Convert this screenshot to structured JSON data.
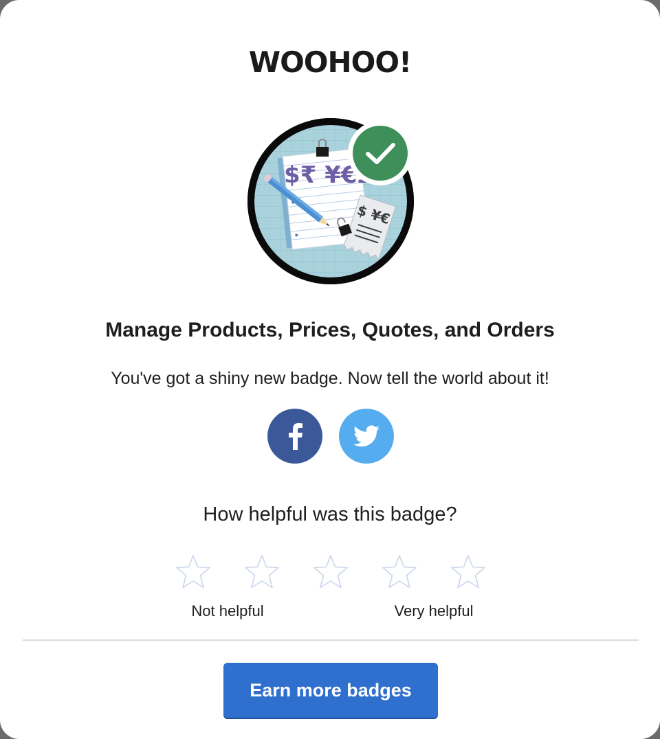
{
  "header": {
    "title": "WOOHOO!"
  },
  "badge": {
    "name": "Manage Products, Prices, Quotes, and Orders",
    "icon": "currency-notepad-badge-icon",
    "status_icon": "checkmark-icon",
    "currency_symbols_main": "$₹ ¥€£",
    "currency_symbols_receipt": "$ ¥€",
    "colors": {
      "badge_bg": "#a9d2dd",
      "ring": "#0a0a0a",
      "check_bg": "#3f8f5b",
      "currency": "#6e5fa5"
    }
  },
  "share": {
    "message": "You've got a shiny new badge. Now tell the world about it!",
    "facebook": {
      "icon": "facebook-icon",
      "color": "#3b5998"
    },
    "twitter": {
      "icon": "twitter-icon",
      "color": "#55acee"
    }
  },
  "rating": {
    "question": "How helpful was this badge?",
    "max_stars": 5,
    "selected": 0,
    "low_label": "Not helpful",
    "high_label": "Very helpful",
    "star_color": "#c9d6ea"
  },
  "footer": {
    "cta_label": "Earn more badges",
    "cta_color": "#2f6fcd"
  }
}
